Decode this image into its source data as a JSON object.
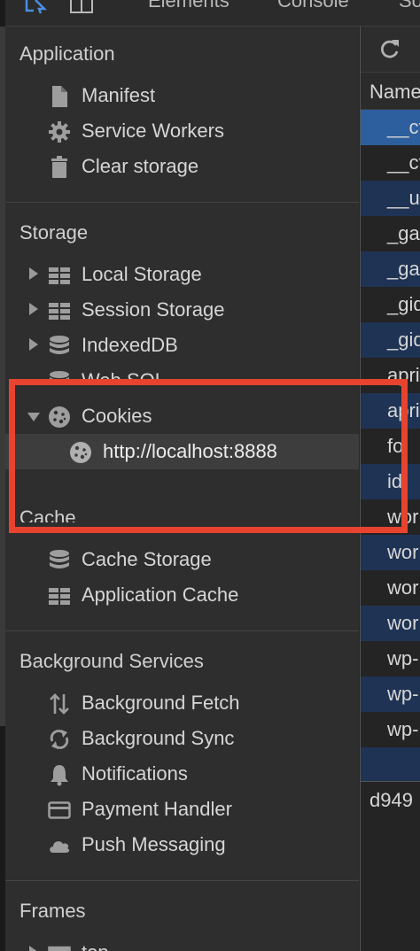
{
  "toolbar": {
    "tabs": [
      "Elements",
      "Console",
      "So"
    ]
  },
  "sidebar": {
    "application": {
      "title": "Application",
      "items": [
        {
          "label": "Manifest",
          "icon": "document-icon"
        },
        {
          "label": "Service Workers",
          "icon": "gear-icon"
        },
        {
          "label": "Clear storage",
          "icon": "trash-icon"
        }
      ]
    },
    "storage": {
      "title": "Storage",
      "items": [
        {
          "label": "Local Storage",
          "icon": "grid-icon"
        },
        {
          "label": "Session Storage",
          "icon": "grid-icon"
        },
        {
          "label": "IndexedDB",
          "icon": "database-icon"
        },
        {
          "label": "Web SQL",
          "icon": "database-icon"
        },
        {
          "label": "Cookies",
          "icon": "cookie-icon"
        },
        {
          "label": "http://localhost:8888",
          "icon": "cookie-icon"
        }
      ]
    },
    "cache": {
      "title": "Cache",
      "items": [
        {
          "label": "Cache Storage",
          "icon": "database-icon"
        },
        {
          "label": "Application Cache",
          "icon": "grid-icon"
        }
      ]
    },
    "background": {
      "title": "Background Services",
      "items": [
        {
          "label": "Background Fetch",
          "icon": "arrows-updown-icon"
        },
        {
          "label": "Background Sync",
          "icon": "sync-icon"
        },
        {
          "label": "Notifications",
          "icon": "bell-icon"
        },
        {
          "label": "Payment Handler",
          "icon": "card-icon"
        },
        {
          "label": "Push Messaging",
          "icon": "cloud-icon"
        }
      ]
    },
    "frames": {
      "title": "Frames",
      "items": [
        {
          "label": "top",
          "icon": "frame-icon"
        }
      ]
    }
  },
  "table": {
    "header": "Name",
    "rows": [
      "__cf",
      "__cf",
      "__ut",
      "_ga",
      "_ga",
      "_gid",
      "_gid",
      "april",
      "april",
      "fo",
      "id",
      "wor",
      "wor",
      "wor",
      "wor",
      "wp-",
      "wp-",
      "wp-",
      ""
    ]
  },
  "footer": {
    "value": "d949"
  },
  "colors": {
    "highlight": "#e8432e",
    "row_selected": "#2d5f9e",
    "row_alt": "#1f3354"
  }
}
